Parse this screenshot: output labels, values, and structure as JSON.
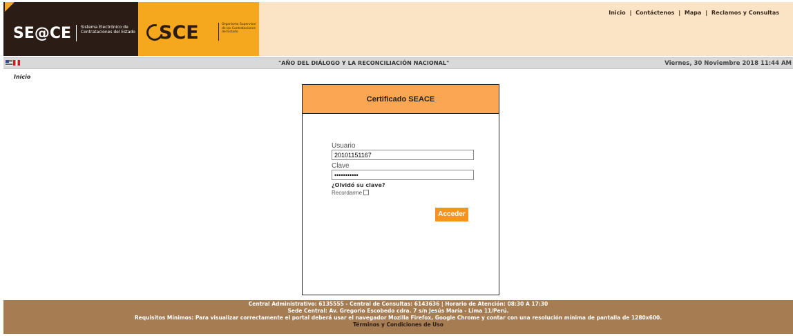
{
  "header": {
    "logo_seace": {
      "word": "SE@CE",
      "subtitle": "Sistema Electrónico de Contrataciones del Estado"
    },
    "logo_osce": {
      "word": "SCE",
      "subtitle": "Organismo Supervisor de las Contrataciones del Estado"
    },
    "links": [
      "Inicio",
      "Contáctenos",
      "Mapa",
      "Reclamos y Consultas"
    ],
    "link_separator": "|"
  },
  "bar": {
    "slogan": "\"AÑO DEL DIÁLOGO Y LA RECONCILIACIÓN NACIONAL\"",
    "date": "Viernes, 30 Noviembre 2018 11:44 AM"
  },
  "breadcrumb": "Inicio",
  "login": {
    "title": "Certificado SEACE",
    "user_label": "Usuario",
    "user_value": "20101151167",
    "password_label": "Clave",
    "password_value": "•••••••••••",
    "forgot": "¿Olvidó su clave?",
    "remember": "Recordarme",
    "remember_checked": false,
    "submit": "Acceder"
  },
  "footer": {
    "line1": "Central Administrativo: 6135555 - Central de Consultas: 6143636 | Horario de Atención: 08:30 A 17:30",
    "line2": "Sede Central: Av. Gregorio Escobedo cdra. 7 s/n Jesús María - Lima 11/Perú.",
    "line3": "Requisitos Mínimos: Para visualizar correctamente el portal deberá usar el navegador Mozilla Firefox, Google Chrome y contar con una resolución mínima de pantalla de 1280x600.",
    "terms": "Términos y Condiciones de Uso"
  },
  "colors": {
    "header_bg": "#fbe3c5",
    "seace_bg": "#2b1d16",
    "osce_bg": "#f5a81e",
    "login_header": "#faa652",
    "button": "#f7941d",
    "footer_bg": "#a67c52"
  },
  "icons": [
    "flag-us-icon",
    "flag-pe-icon",
    "checkbox-icon"
  ]
}
